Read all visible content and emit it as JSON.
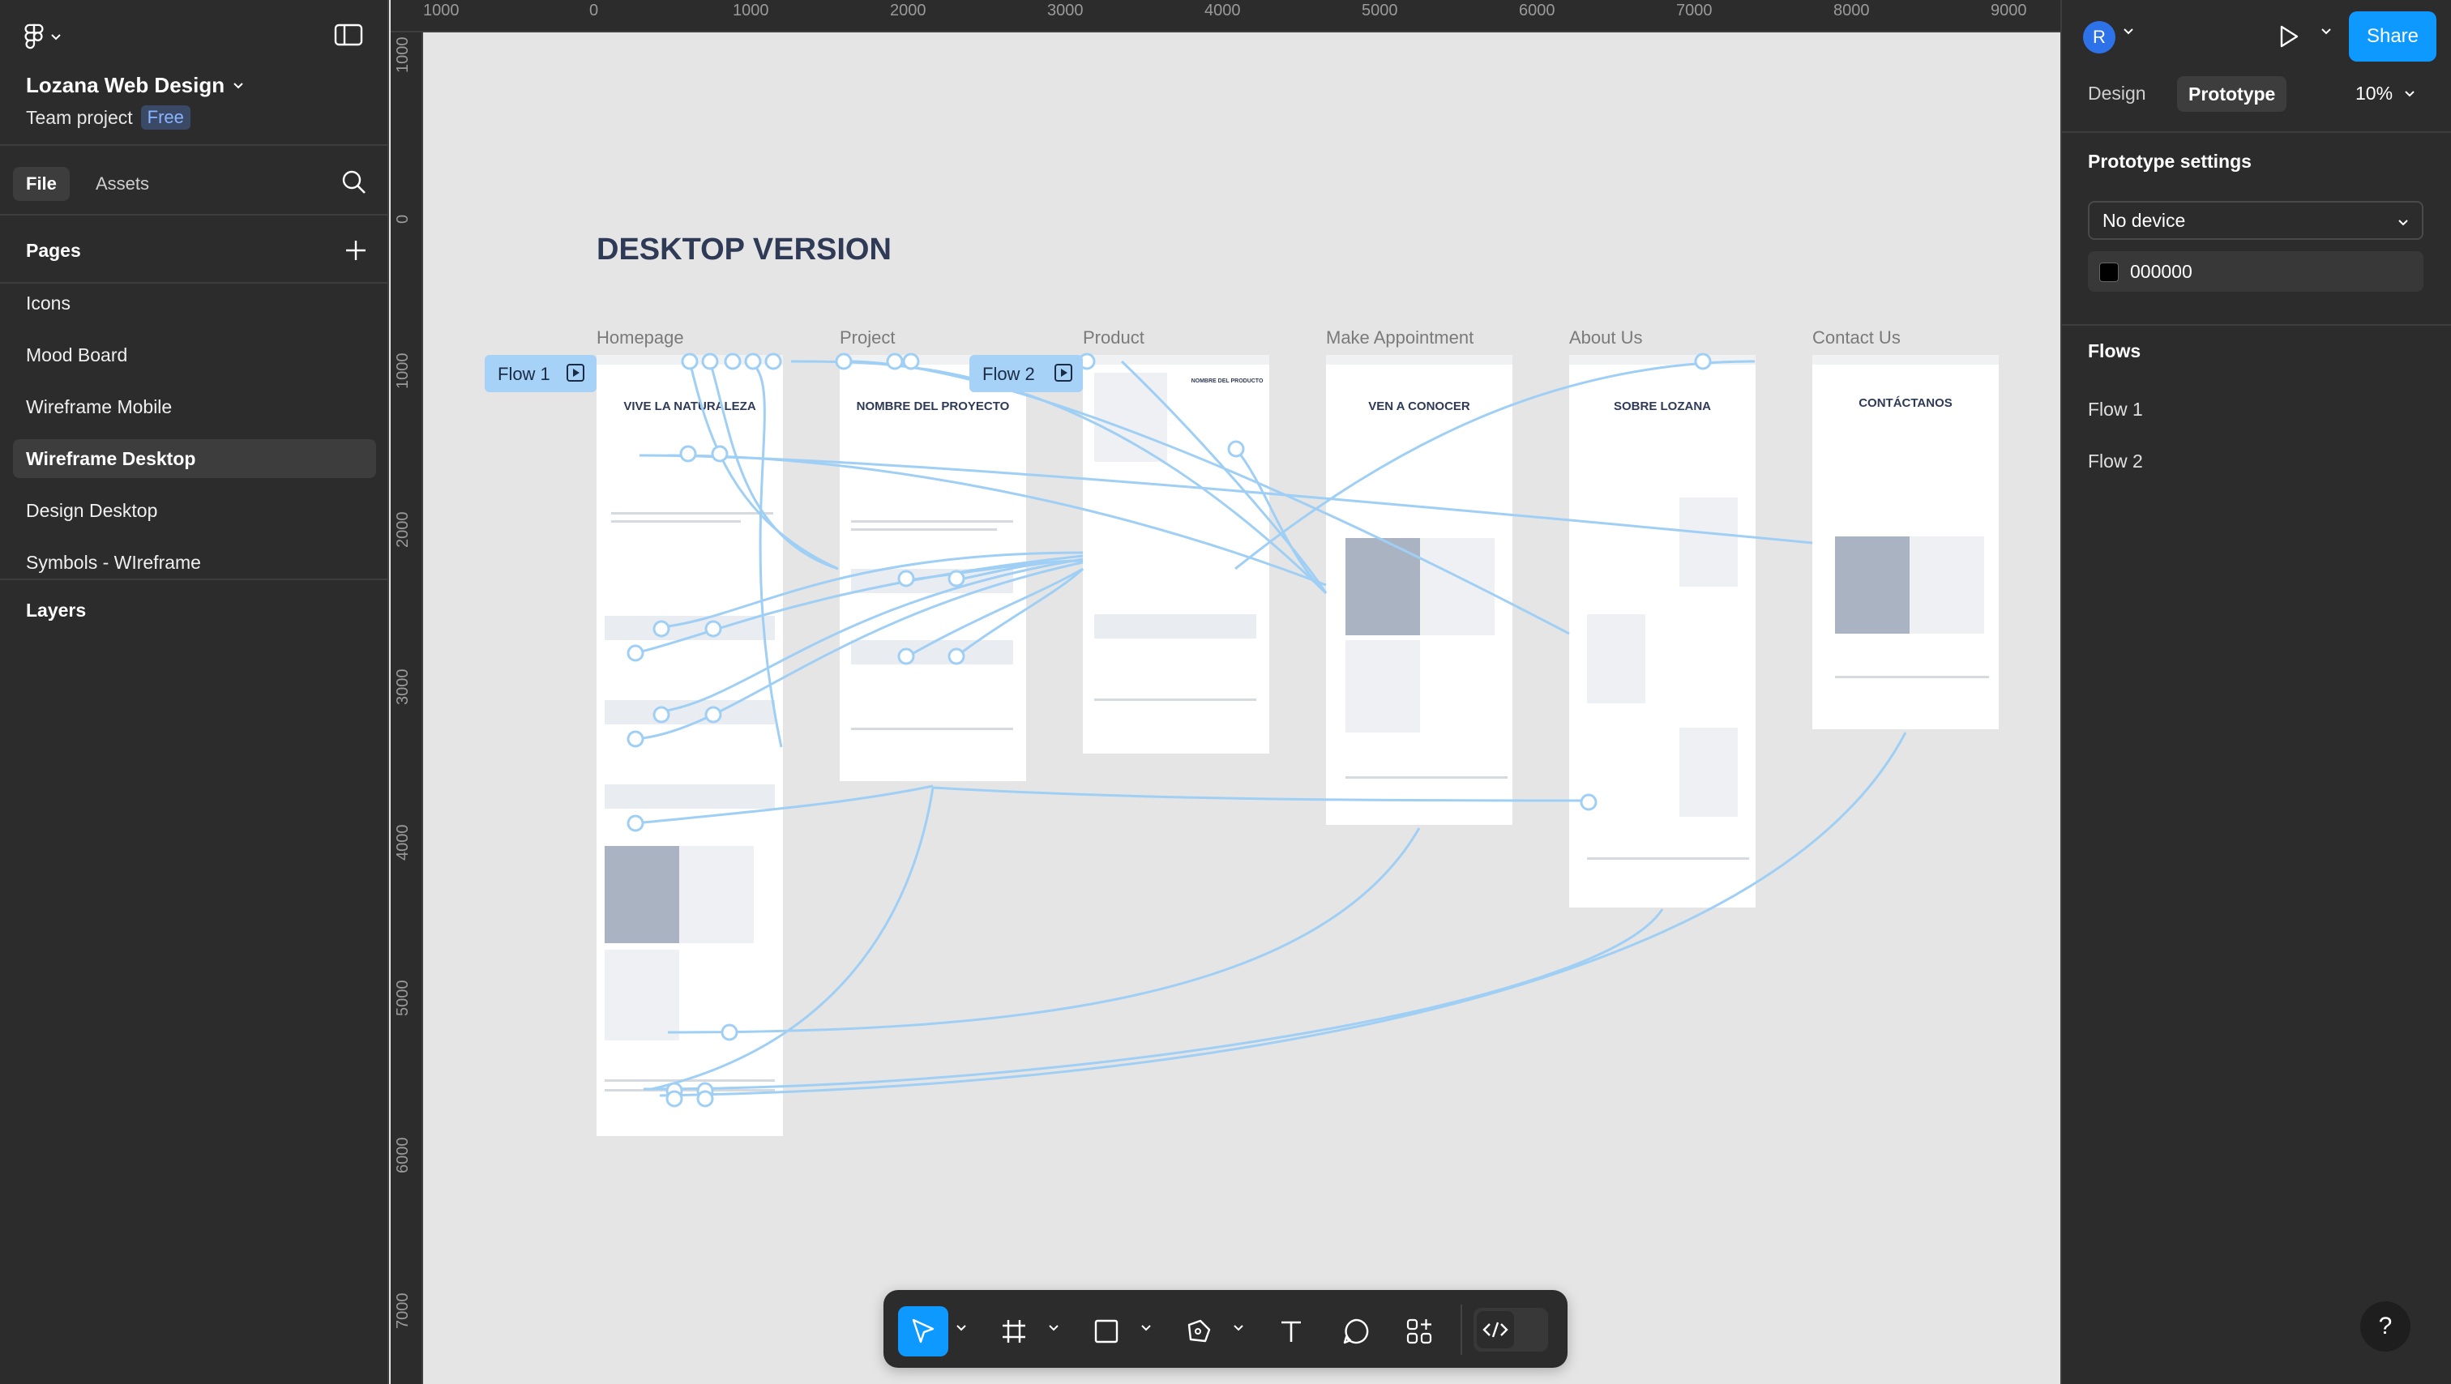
{
  "file": {
    "name": "Lozana Web Design",
    "team": "Team project",
    "plan_badge": "Free"
  },
  "left_tabs": {
    "file": "File",
    "assets": "Assets"
  },
  "pages": {
    "heading": "Pages",
    "items": [
      {
        "label": "Icons",
        "selected": false
      },
      {
        "label": "Mood Board",
        "selected": false
      },
      {
        "label": "Wireframe Mobile",
        "selected": false
      },
      {
        "label": "Wireframe Desktop",
        "selected": true
      },
      {
        "label": "Design Desktop",
        "selected": false
      },
      {
        "label": "Symbols - WIreframe",
        "selected": false
      }
    ]
  },
  "layers_heading": "Layers",
  "ruler": {
    "top": [
      "1000",
      "0",
      "1000",
      "2000",
      "3000",
      "4000",
      "5000",
      "6000",
      "7000",
      "8000",
      "9000"
    ],
    "left": [
      "1000",
      "0",
      "1000",
      "2000",
      "3000",
      "4000",
      "5000",
      "6000",
      "7000"
    ]
  },
  "canvas": {
    "section_title": "DESKTOP VERSION",
    "frames": [
      {
        "label": "Homepage",
        "heading": "VIVE LA NATURALEZA"
      },
      {
        "label": "Project",
        "heading": "NOMBRE DEL PROYECTO"
      },
      {
        "label": "Product",
        "heading": "NOMBRE DEL PRODUCTO"
      },
      {
        "label": "Make Appointment",
        "heading": "VEN A CONOCER"
      },
      {
        "label": "About Us",
        "heading": "SOBRE LOZANA"
      },
      {
        "label": "Contact Us",
        "heading": "CONTÁCTANOS"
      }
    ],
    "flow_tags": [
      "Flow 1",
      "Flow 2"
    ]
  },
  "right_panel": {
    "avatar_initial": "R",
    "share": "Share",
    "tabs": {
      "design": "Design",
      "prototype": "Prototype"
    },
    "zoom": "10%",
    "prototype_settings": "Prototype settings",
    "device": "No device",
    "background_color": "000000",
    "flows_heading": "Flows",
    "flows": [
      "Flow 1",
      "Flow 2"
    ],
    "help": "?"
  },
  "toolbar": {
    "tools": [
      "move-tool",
      "frame-tool",
      "rectangle-tool",
      "pen-tool",
      "text-tool",
      "comment-tool",
      "actions-tool"
    ],
    "active_tool": "move-tool"
  },
  "colors": {
    "accent": "#0d99ff",
    "panel_bg": "#2c2c2c",
    "canvas_bg": "#e5e5e5",
    "flow_connector": "#9fcff5",
    "frame_heading": "#2f3a57"
  }
}
